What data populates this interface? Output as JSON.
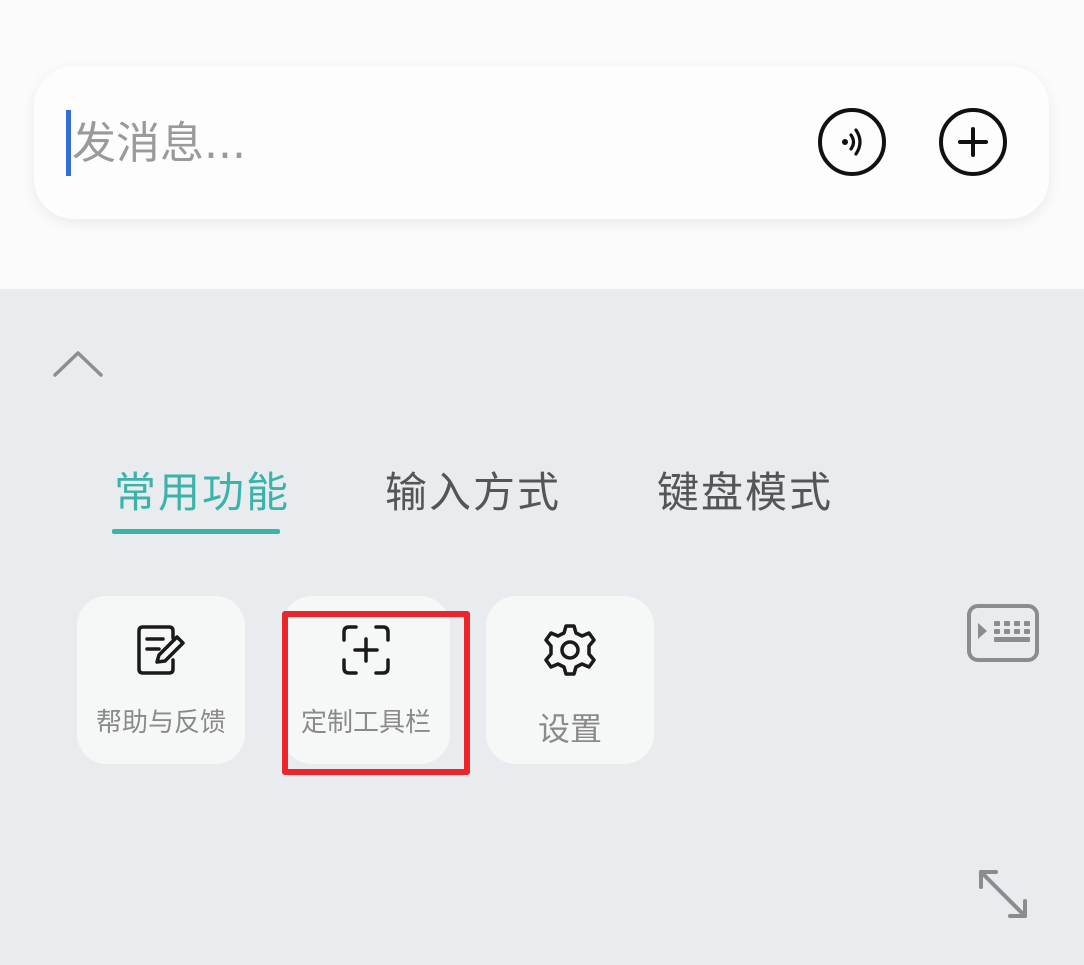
{
  "message_bar": {
    "placeholder": "发消息...",
    "voice_icon": "voice-wave-icon",
    "plus_icon": "plus-circle-icon"
  },
  "panel": {
    "collapse_icon": "chevron-up-icon",
    "tabs": [
      {
        "label": "常用功能",
        "active": true
      },
      {
        "label": "输入方式",
        "active": false
      },
      {
        "label": "键盘模式",
        "active": false
      }
    ],
    "tools": [
      {
        "label": "帮助与反馈",
        "icon": "edit-note-icon"
      },
      {
        "label": "定制工具栏",
        "icon": "add-frame-icon"
      },
      {
        "label": "设置",
        "icon": "gear-icon"
      }
    ],
    "keyboard_icon": "keyboard-icon",
    "expand_icon": "expand-arrows-icon"
  },
  "colors": {
    "accent": "#3cb3aa",
    "highlight": "#e8262c",
    "panel_bg": "#e8ecef",
    "caret": "#2f6fd6"
  }
}
